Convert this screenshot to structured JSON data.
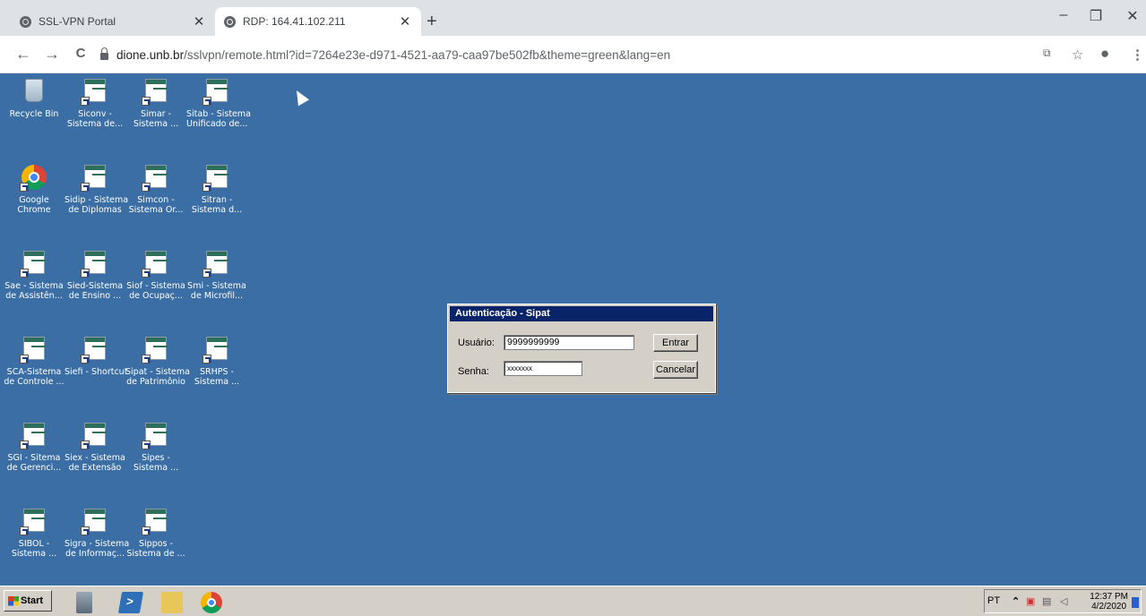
{
  "browser": {
    "tabs": [
      {
        "title": "SSL-VPN Portal",
        "active": false
      },
      {
        "title": "RDP: 164.41.102.211",
        "active": true
      }
    ],
    "new_tab": "+",
    "controls": {
      "minimize": "–",
      "restore": "❐",
      "close": "✕"
    },
    "nav": {
      "back": "←",
      "forward": "→",
      "reload": "C"
    },
    "url": {
      "host": "dione.unb.br",
      "path": "/sslvpn/remote.html?id=7264e23e-d971-4521-aa79-caa97be502fb&theme=green&lang=en"
    },
    "toolbar_icons": [
      "translate-icon",
      "star-icon",
      "account-icon",
      "menu-icon"
    ]
  },
  "desktop": {
    "background": "#3a6ea5",
    "icons": [
      {
        "label1": "Recycle Bin",
        "label2": "",
        "type": "recycle-bin"
      },
      {
        "label1": "Siconv -",
        "label2": "Sistema de...",
        "type": "app"
      },
      {
        "label1": "Simar -",
        "label2": "Sistema ...",
        "type": "app"
      },
      {
        "label1": "Sitab - Sistema",
        "label2": "Unificado de...",
        "type": "app"
      },
      {
        "label1": "Google",
        "label2": "Chrome",
        "type": "chrome"
      },
      {
        "label1": "Sidip - Sistema",
        "label2": "de Diplomas",
        "type": "app"
      },
      {
        "label1": "Simcon -",
        "label2": "Sistema Or...",
        "type": "app"
      },
      {
        "label1": "Sitran -",
        "label2": "Sistema d...",
        "type": "app"
      },
      {
        "label1": "Sae - Sistema",
        "label2": "de Assistên...",
        "type": "app"
      },
      {
        "label1": "Sied-Sistema",
        "label2": "de Ensino ...",
        "type": "app"
      },
      {
        "label1": "Siof - Sistema",
        "label2": "de Ocupaç...",
        "type": "app"
      },
      {
        "label1": "Smi - Sistema",
        "label2": "de Microfil...",
        "type": "app"
      },
      {
        "label1": "SCA-Sistema",
        "label2": "de Controle ...",
        "type": "app"
      },
      {
        "label1": "Siefi - Shortcut",
        "label2": "",
        "type": "app"
      },
      {
        "label1": "Sipat - Sistema",
        "label2": "de Patrimônio",
        "type": "app"
      },
      {
        "label1": "SRHPS -",
        "label2": "Sistema ...",
        "type": "app"
      },
      {
        "label1": "SGI - Sitema",
        "label2": "de Gerenci...",
        "type": "app"
      },
      {
        "label1": "Siex - Sistema",
        "label2": "de Extensão",
        "type": "app"
      },
      {
        "label1": "Sipes -",
        "label2": "Sistema ...",
        "type": "app"
      },
      {
        "label1": "SIBOL -",
        "label2": "Sistema ...",
        "type": "app"
      },
      {
        "label1": "Sigra - Sistema",
        "label2": "de Informaç...",
        "type": "app"
      },
      {
        "label1": "Sippos -",
        "label2": "Sistema de ...",
        "type": "app"
      }
    ]
  },
  "dialog": {
    "title": "Autenticação - Sipat",
    "user_label": "Usuário:",
    "user_value": "9999999999",
    "password_label": "Senha:",
    "password_value": "xxxxxxx",
    "ok_label": "Entrar",
    "cancel_label": "Cancelar"
  },
  "taskbar": {
    "start_label": "Start",
    "quicklaunch": [
      "server-manager-icon",
      "powershell-icon",
      "explorer-icon",
      "chrome-icon"
    ],
    "language": "PT",
    "time": "12:37 PM",
    "date": "4/2/2020"
  }
}
